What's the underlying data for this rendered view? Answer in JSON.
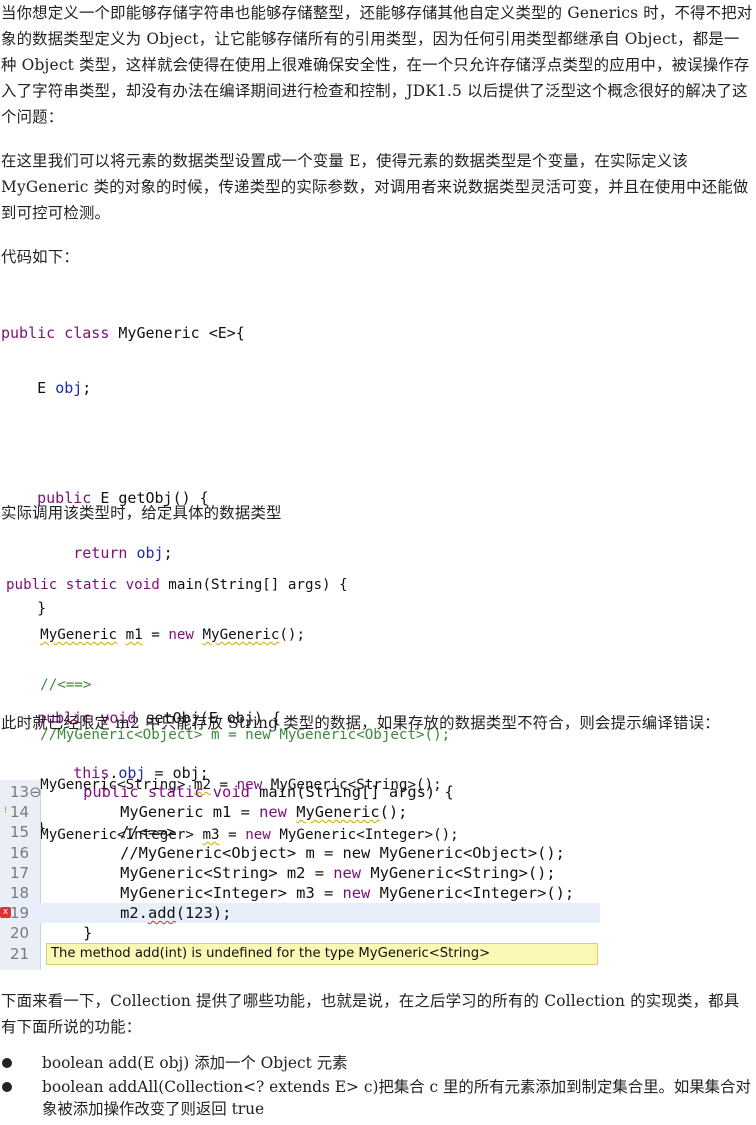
{
  "paragraphs": {
    "p1": "当你想定义一个即能够存储字符串也能够存储整型，还能够存储其他自定义类型的 Generics 时，不得不把对象的数据类型定义为 Object，让它能够存储所有的引用类型，因为任何引用类型都继承自 Object，都是一种 Object 类型，这样就会使得在使用上很难确保安全性，在一个只允许存储浮点类型的应用中，被误操作存入了字符串类型，却没有办法在编译期间进行检查和控制，JDK1.5 以后提供了泛型这个概念很好的解决了这个问题：",
    "p2": "在这里我们可以将元素的数据类型设置成一个变量 E，使得元素的数据类型是个变量，在实际定义该 MyGeneric 类的对象的时候，传递类型的实际参数，对调用者来说数据类型灵活可变，并且在使用中还能做到可控可检测。",
    "p3": "代码如下：",
    "p4": "实际调用该类型时，给定具体的数据类型",
    "p5": "此时就已经限定 m2 中只能存放 String 类型的数据，如果存放的数据类型不符合，则会提示编译错误：",
    "p6": "下面来看一下，Collection 提供了哪些功能，也就是说，在之后学习的所有的 Collection 的实现类，都具有下面所说的功能："
  },
  "code1": {
    "l1_kw": "public class",
    "l1_rest": " MyGeneric <E>{",
    "l2_a": "    E ",
    "l2_fld": "obj",
    "l2_b": ";",
    "l4_kw": "    public",
    "l4_rest": " E getObj() {",
    "l5_kw": "        return",
    "l5_sp": " ",
    "l5_fld": "obj",
    "l5_b": ";",
    "l6": "    }",
    "l8_kw": "    public void",
    "l8_rest": " setObj(E obj) {",
    "l9_kw": "        this",
    "l9_dot": ".",
    "l9_fld": "obj",
    "l9_rest": " = obj;",
    "l10": "    }"
  },
  "code2": {
    "l1_kw": "public static void",
    "l1_rest": " main(String[] args) {",
    "l2_a": "    ",
    "l2_sq1": "MyGeneric",
    "l2_b": " ",
    "l2_sq2": "m1",
    "l2_c": " = ",
    "l2_kw": "new",
    "l2_d": " ",
    "l2_sq3": "MyGeneric",
    "l2_e": "();",
    "l3": "    //<==>",
    "l4": "    //MyGeneric<Object> m = new MyGeneric<Object>();",
    "l5_a": "    MyGeneric<String> ",
    "l5_sq": "m2",
    "l5_b": " = ",
    "l5_kw": "new",
    "l5_c": " MyGeneric<String>();",
    "l6_a": "    MyGeneric<Integer> ",
    "l6_sq": "m3",
    "l6_b": " = ",
    "l6_kw": "new",
    "l6_c": " MyGeneric<Integer>();",
    "l8": "}"
  },
  "ide": {
    "lines": [
      {
        "num": "13⊖",
        "kw": "    public static void",
        "rest": " main(String[] args) {"
      },
      {
        "num": "14"
      },
      {
        "num": "15",
        "comment": "        //<==>"
      },
      {
        "num": "16",
        "comment": "        //MyGeneric<Object> m = new MyGeneric<Object>();"
      },
      {
        "num": "17"
      },
      {
        "num": "18"
      },
      {
        "num": "19"
      },
      {
        "num": "20",
        "text": "    }"
      },
      {
        "num": "21"
      }
    ],
    "l14": {
      "a": "        MyGeneric m1 = ",
      "kw": "new",
      "b": " ",
      "sq": "MyGeneric",
      "c": "();"
    },
    "l17": {
      "a": "        MyGeneric<String> m2 = ",
      "kw": "new",
      "b": " MyGeneric<String>();"
    },
    "l18": {
      "a": "        MyGeneric<Integer> m3 = ",
      "kw": "new",
      "b": " MyGeneric<Integer>();"
    },
    "l19": {
      "a": "        m2.",
      "sq": "add",
      "b": "(123);"
    },
    "warn_icon": "!",
    "err_icon": "x",
    "tooltip": "The method add(int) is undefined for the type MyGeneric<String>"
  },
  "bullets": [
    "boolean add(E obj)  添加一个 Object 元素",
    "boolean addAll(Collection<? extends E> c)把集合 c 里的所有元素添加到制定集合里。如果集合对象被添加操作改变了则返回 true"
  ]
}
